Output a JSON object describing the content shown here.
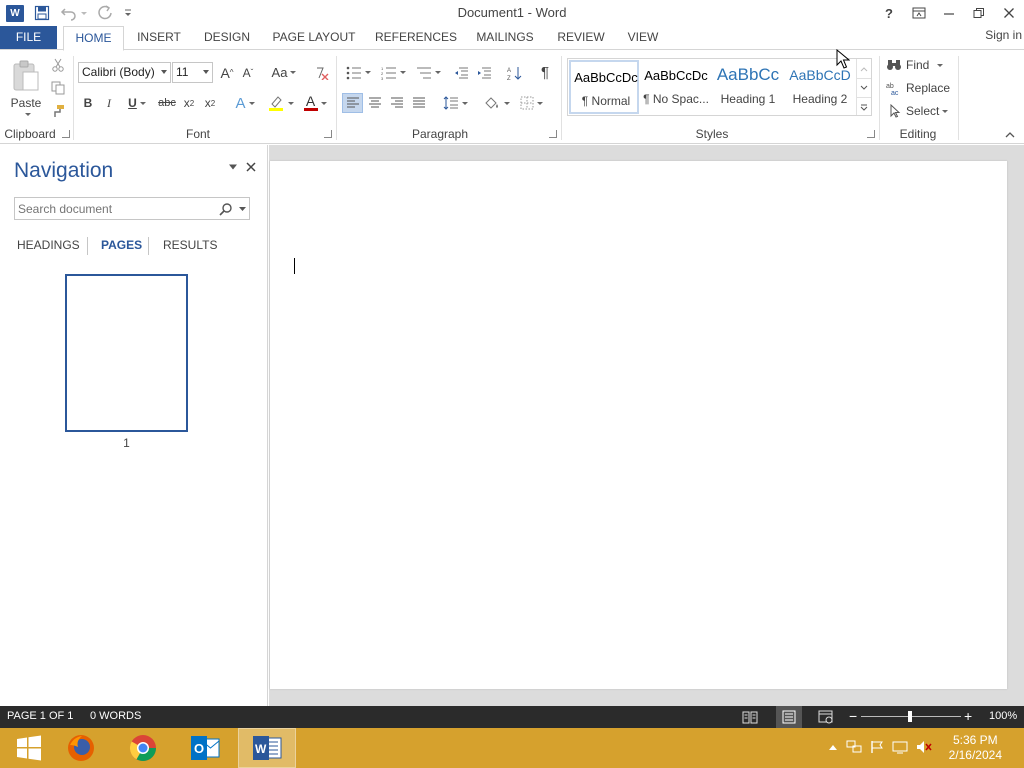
{
  "colors": {
    "accent": "#2b579a",
    "status_bar": "#2b2b2b",
    "taskbar": "#d6a12d"
  },
  "title_bar": {
    "document_title": "Document1 - Word"
  },
  "quick_access": {
    "icons": [
      "word-logo-icon",
      "save-icon",
      "undo-icon",
      "redo-icon",
      "customize-qat-icon"
    ]
  },
  "window_controls": {
    "help": "?",
    "icons": [
      "help-icon",
      "ribbon-display-options-icon",
      "minimize-icon",
      "restore-icon",
      "close-icon"
    ]
  },
  "tabs": {
    "file": "FILE",
    "items": [
      "HOME",
      "INSERT",
      "DESIGN",
      "PAGE LAYOUT",
      "REFERENCES",
      "MAILINGS",
      "REVIEW",
      "VIEW"
    ],
    "active": "HOME",
    "sign_in": "Sign in"
  },
  "ribbon": {
    "clipboard": {
      "label": "Clipboard",
      "paste": "Paste"
    },
    "font": {
      "label": "Font",
      "font_name": "Calibri (Body)",
      "font_size": "11",
      "case_button": "Aa",
      "bold": "B",
      "italic": "I",
      "underline": "U",
      "strikethrough": "abc",
      "subscript": "x",
      "subscript_mark": "2",
      "superscript": "x",
      "superscript_mark": "2",
      "text_effects": "A",
      "font_color": "A"
    },
    "paragraph": {
      "label": "Paragraph",
      "pilcrow": "¶"
    },
    "styles": {
      "label": "Styles",
      "items": [
        {
          "sample": "AaBbCcDc",
          "name": "¶ Normal",
          "selected": true
        },
        {
          "sample": "AaBbCcDc",
          "name": "¶ No Spac...",
          "selected": false
        },
        {
          "sample": "AaBbCc",
          "name": "Heading 1",
          "selected": false
        },
        {
          "sample": "AaBbCcD",
          "name": "Heading 2",
          "selected": false
        }
      ]
    },
    "editing": {
      "label": "Editing",
      "find": "Find",
      "replace": "Replace",
      "select": "Select"
    }
  },
  "navigation": {
    "title": "Navigation",
    "search_placeholder": "Search document",
    "tabs": [
      "HEADINGS",
      "PAGES",
      "RESULTS"
    ],
    "active_tab": "PAGES",
    "thumbnail_page_number": "1"
  },
  "status_bar": {
    "page": "PAGE 1 OF 1",
    "words": "0 WORDS",
    "zoom": "100%",
    "zoom_minus": "−",
    "zoom_plus": "+"
  },
  "taskbar": {
    "apps": [
      "windows-start-icon",
      "firefox-icon",
      "chrome-icon",
      "outlook-icon",
      "word-icon"
    ],
    "active_app": "word-icon",
    "time": "5:36 PM",
    "date": "2/16/2024"
  }
}
